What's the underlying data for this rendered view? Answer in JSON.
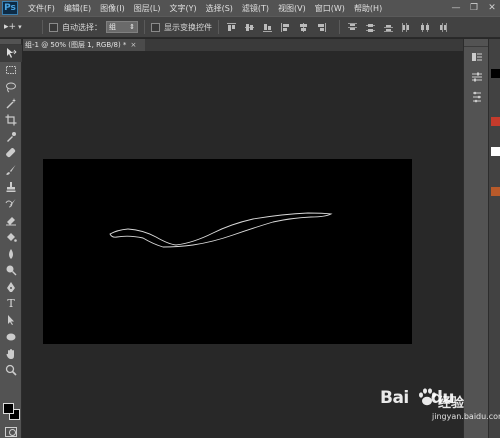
{
  "app": {
    "logo": "Ps"
  },
  "menu": [
    "文件(F)",
    "编辑(E)",
    "图像(I)",
    "图层(L)",
    "文字(Y)",
    "选择(S)",
    "滤镜(T)",
    "视图(V)",
    "窗口(W)",
    "帮助(H)"
  ],
  "window_controls": {
    "minimize": "—",
    "restore": "❐",
    "close": "✕"
  },
  "options": {
    "tool_preset_glyph": "▸+",
    "tool_preset_arrow": "▾",
    "auto_select_label": "自动选择：",
    "auto_select_value": "组",
    "auto_select_arrow": "⇕",
    "show_transform_label": "显示变换控件"
  },
  "document": {
    "tab_label": "组-1 @ 50% (图层 1, RGB/8) *",
    "tab_close": "×",
    "canvas_color": "#000000",
    "path_color": "#d9d9d9"
  },
  "colors": {
    "foreground": "#000000",
    "background": "#000000",
    "accent_red": "#c43b2c",
    "accent_orange": "#b85a2a"
  },
  "tools": [
    "move-tool",
    "marquee-tool",
    "lasso-tool",
    "magic-wand-tool",
    "crop-tool",
    "eyedropper-tool",
    "healing-brush-tool",
    "brush-tool",
    "clone-stamp-tool",
    "history-brush-tool",
    "eraser-tool",
    "paint-bucket-tool",
    "blur-tool",
    "dodge-tool",
    "pen-tool",
    "type-tool",
    "path-selection-tool",
    "shape-tool",
    "hand-tool",
    "zoom-tool"
  ],
  "type_tool_glyph": "T",
  "watermark": {
    "brand": "Bai",
    "brand_suffix": "du",
    "service": "经验",
    "url": "jingyan.baidu.com"
  }
}
